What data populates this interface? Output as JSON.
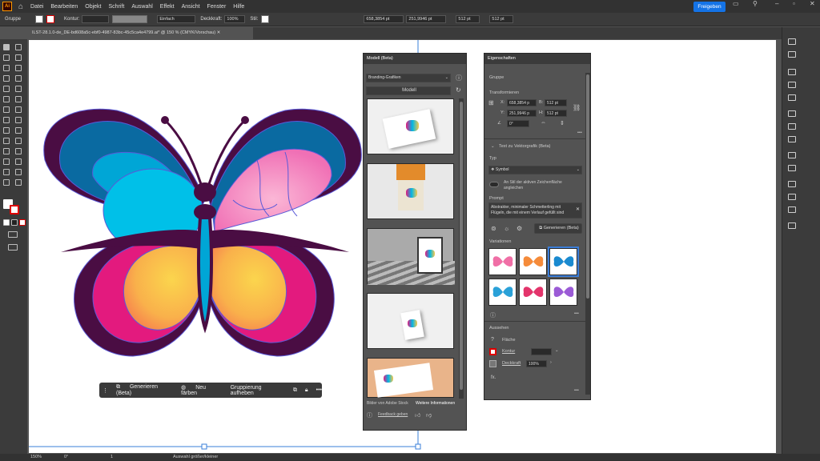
{
  "app": {
    "logo": "Ai",
    "menus": [
      "Datei",
      "Bearbeiten",
      "Objekt",
      "Schrift",
      "Auswahl",
      "Effekt",
      "Ansicht",
      "Fenster",
      "Hilfe"
    ],
    "share_label": "Freigeben"
  },
  "control_bar": {
    "selection_type": "Gruppe",
    "stroke_label": "Kontur:",
    "stroke_style": "Einfach",
    "opacity_label": "Deckkraft:",
    "opacity": "100%",
    "style_label": "Stil:",
    "x": "658,3854 pt",
    "y": "251,9946 pt",
    "w": "512 pt",
    "h": "512 pt"
  },
  "document": {
    "tab_title": "ILST-28.1.0-de_DE-bd608a5c-ebf0-4987-83bc-45c5ca4e4799.ai* @ 150 % (CMYK/Vorschau)"
  },
  "float_bar": {
    "generate": "Generieren (Beta)",
    "recolor": "Neu färben",
    "ungroup": "Gruppierung aufheben"
  },
  "model_panel": {
    "title": "Modell (Beta)",
    "category": "Branding-Grafiken",
    "model_button": "Modell",
    "footer_left": "Bilder von Adobe Stock",
    "footer_right": "Weitere Informationen",
    "feedback": "Feedback geben"
  },
  "properties_panel": {
    "title": "Eigenschaften",
    "group_label": "Gruppe",
    "transform_label": "Transformieren",
    "x_label": "X:",
    "x": "658,3854 p",
    "w_label": "B:",
    "w": "512 pt",
    "y_label": "Y:",
    "y": "251,9946 p",
    "h_label": "H:",
    "h": "512 pt",
    "angle": "0°",
    "t2v_title": "Text zu Vektorgrafik (Beta)",
    "type_label": "Typ",
    "type_value": "Symbol",
    "match_label_1": "An Stil der aktiven Zeichenfläche",
    "match_label_2": "angleichen",
    "prompt_label": "Prompt",
    "prompt_text_1": "Abstrakter, minimaler Schmetterling mit",
    "prompt_text_2": "Flügeln, die mit einem Verlauf gefüllt sind",
    "generate_button": "Generieren (Beta)",
    "variations_label": "Variationen",
    "appearance_label": "Aussehen",
    "fill_label": "Fläche",
    "stroke_label": "Kontur",
    "opacity_label": "Deckkraft",
    "opacity_value": "100%",
    "fx_label": "fx."
  },
  "status_bar": {
    "zoom": "150%",
    "angle": "0°",
    "artboard": "1",
    "tool_hint": "Auswahl größer/kleiner"
  },
  "colors": {
    "accent": "#1473e6",
    "butterfly_dark": "#4a0d43",
    "butterfly_blue": "#0a6aa1",
    "butterfly_cyan": "#00b8e6",
    "butterfly_pink": "#e31a7e",
    "butterfly_yellow": "#f9c84a"
  }
}
